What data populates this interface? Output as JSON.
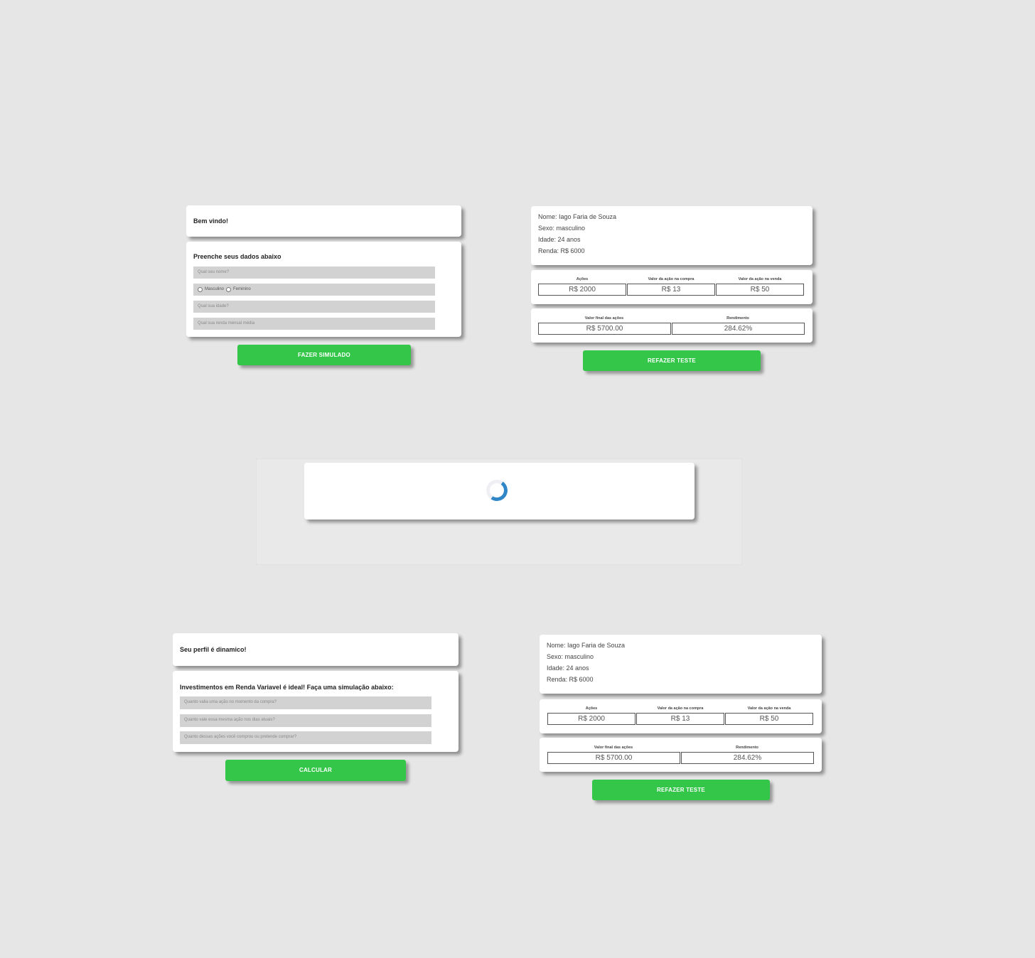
{
  "screen1": {
    "welcome": "Bem vindo!",
    "form_title": "Preenche seus dados abaixo",
    "name_placeholder": "Qual seu nome?",
    "gender_male": "Masculino",
    "gender_female": "Feminino",
    "age_placeholder": "Qual sua idade?",
    "income_placeholder": "Qual sua renda mensal média",
    "button": "FAZER SIMULADO"
  },
  "result": {
    "nome": "Nome: Iago Faria de Souza",
    "sexo": "Sexo: masculino",
    "idade": "Idade: 24 anos",
    "renda": "Renda: R$ 6000",
    "headers": [
      "Ações",
      "Valor da ação na compra",
      "Valor da ação na venda"
    ],
    "values": [
      "R$ 2000",
      "R$ 13",
      "R$ 50"
    ],
    "final_headers": [
      "Valor final das ações",
      "Rendimento"
    ],
    "final_values": [
      "R$ 5700.00",
      "284.62%"
    ],
    "button": "REFAZER TESTE"
  },
  "screen3": {
    "profile": "Seu perfil é dinamico!",
    "subtitle": "Investimentos em Renda Variavel é ideal! Faça uma simulação abaixo:",
    "q1_placeholder": "Quanto valia uma ação no momento da compra?",
    "q2_placeholder": "Quanto vale essa mesma ação nos dias atuais?",
    "q3_placeholder": "Quanto dessas ações você comprou ou pretende comprar?",
    "button": "CALCULAR"
  },
  "colors": {
    "accent_green": "#33c649",
    "spinner_blue": "#3186c7",
    "background": "#e6e6e6"
  }
}
